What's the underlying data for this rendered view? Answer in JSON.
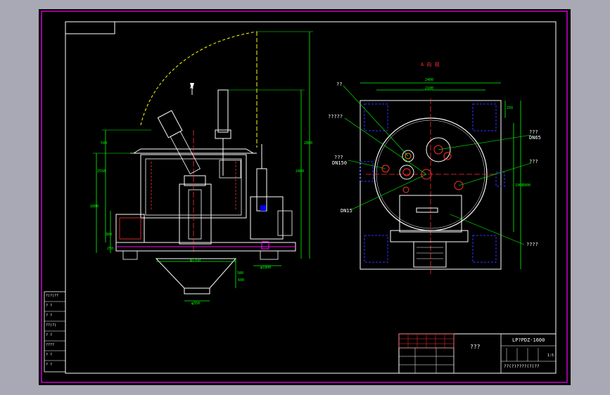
{
  "drawing": {
    "top_view_title": "A 向 视",
    "view_marker": "A",
    "side_view": {
      "dims_left": [
        "540",
        "1800",
        "2550",
        "380",
        "250",
        "580"
      ],
      "dims_right": [
        "2800",
        "2400"
      ],
      "dims_bottom": [
        "φ1350",
        "φ1800",
        "φ350",
        "600"
      ]
    },
    "top_view": {
      "dims_top": [
        "2400",
        "2100"
      ],
      "dims_right": [
        "2800",
        "1900",
        "250"
      ],
      "callouts": [
        "??",
        "?????",
        "???",
        "DN150",
        "DN15",
        "???",
        "DN65",
        "???",
        "????"
      ]
    }
  },
  "left_table": {
    "rows": [
      "?(?)??",
      "? ?",
      "? ?",
      "??(?)",
      "? ?",
      "????",
      "? ?",
      "? ?"
    ]
  },
  "title_block": {
    "drawing_name": "???",
    "product_code": "LP?PDZ-1600",
    "page": "1:5",
    "company": "??(?)????(?)??"
  }
}
